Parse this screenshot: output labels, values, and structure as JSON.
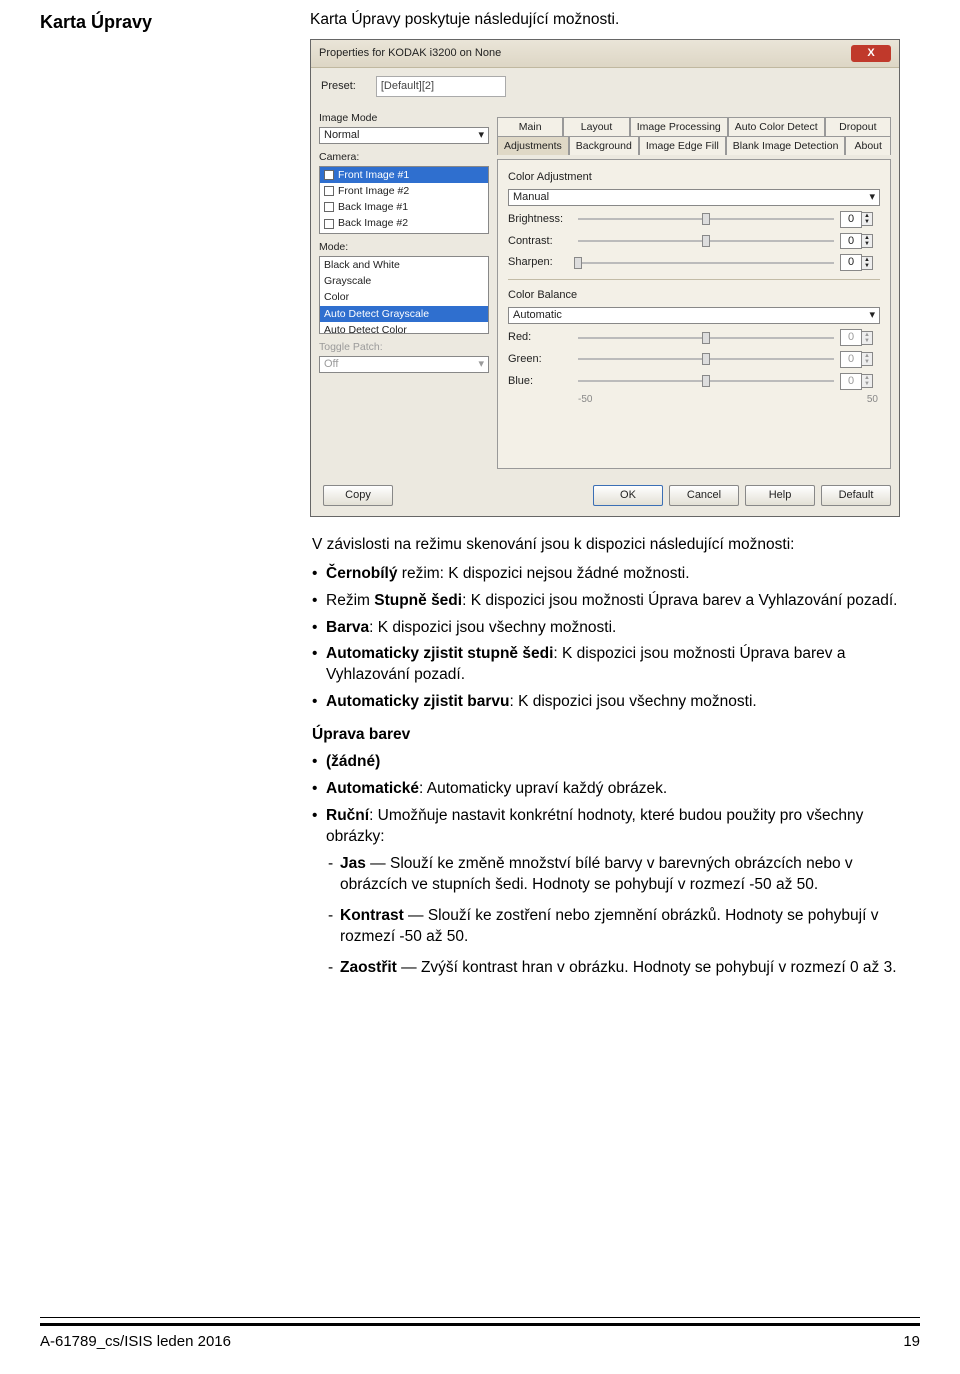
{
  "heading": "Karta Úpravy",
  "intro": "Karta Úpravy poskytuje následující možnosti.",
  "dialog": {
    "title": "Properties for KODAK i3200 on None",
    "close_x": "X",
    "preset_label": "Preset:",
    "preset_value": "[Default][2]",
    "left": {
      "image_mode_label": "Image Mode",
      "image_mode_value": "Normal",
      "camera_label": "Camera:",
      "camera_items": [
        "Front Image #1",
        "Front Image #2",
        "Back Image #1",
        "Back Image #2"
      ],
      "mode_label": "Mode:",
      "mode_items": [
        "Black and White",
        "Grayscale",
        "Color",
        "Auto Detect Grayscale",
        "Auto Detect Color"
      ],
      "mode_selected_index": 3,
      "toggle_label": "Toggle Patch:",
      "toggle_value": "Off"
    },
    "tabs_top": [
      "Main",
      "Layout",
      "Image Processing",
      "Auto Color Detect",
      "Dropout"
    ],
    "tabs_bot": [
      "Adjustments",
      "Background",
      "Image Edge Fill",
      "Blank Image Detection",
      "About"
    ],
    "tabs_selected": "Adjustments",
    "adjust": {
      "ca_label": "Color Adjustment",
      "ca_value": "Manual",
      "brightness_label": "Brightness:",
      "contrast_label": "Contrast:",
      "sharpen_label": "Sharpen:",
      "zero": "0",
      "cb_label": "Color Balance",
      "cb_value": "Automatic",
      "red_label": "Red:",
      "green_label": "Green:",
      "blue_label": "Blue:",
      "axis_min": "-50",
      "axis_max": "50"
    },
    "buttons": {
      "copy": "Copy",
      "ok": "OK",
      "cancel": "Cancel",
      "help": "Help",
      "default": "Default"
    }
  },
  "below_intro": "V závislosti na režimu skenování jsou k dispozici následující možnosti:",
  "modes": [
    {
      "b": "Černobílý",
      "rest": " režim: K dispozici nejsou žádné možnosti."
    },
    {
      "pre": "Režim ",
      "b": "Stupně šedi",
      "rest": ": K dispozici jsou možnosti Úprava barev a Vyhlazování pozadí."
    },
    {
      "b": "Barva",
      "rest": ": K dispozici jsou všechny možnosti."
    },
    {
      "b": "Automaticky zjistit stupně šedi",
      "rest": ": K dispozici jsou možnosti Úprava barev a Vyhlazování pozadí."
    },
    {
      "b": "Automaticky zjistit barvu",
      "rest": ": K dispozici jsou všechny možnosti."
    }
  ],
  "ub_title": "Úprava barev",
  "ub_items": [
    {
      "b": "(žádné)",
      "rest": ""
    },
    {
      "b": "Automatické",
      "rest": ": Automaticky upraví každý obrázek."
    },
    {
      "b": "Ruční",
      "rest": ": Umožňuje nastavit konkrétní hodnoty, které budou použity pro všechny obrázky:"
    }
  ],
  "manual_sub": [
    {
      "b": "Jas",
      "rest": " — Slouží ke změně množství bílé barvy v barevných obrázcích nebo v obrázcích ve stupních šedi. Hodnoty se pohybují v rozmezí -50 až 50."
    },
    {
      "b": "Kontrast",
      "rest": " — Slouží ke zostření nebo zjemnění obrázků. Hodnoty se pohybují v rozmezí -50 až 50."
    },
    {
      "b": "Zaostřit",
      "rest": " — Zvýší kontrast hran v obrázku. Hodnoty se pohybují v rozmezí 0 až 3."
    }
  ],
  "footer_left": "A-61789_cs/ISIS  leden  2016",
  "footer_right": "19"
}
